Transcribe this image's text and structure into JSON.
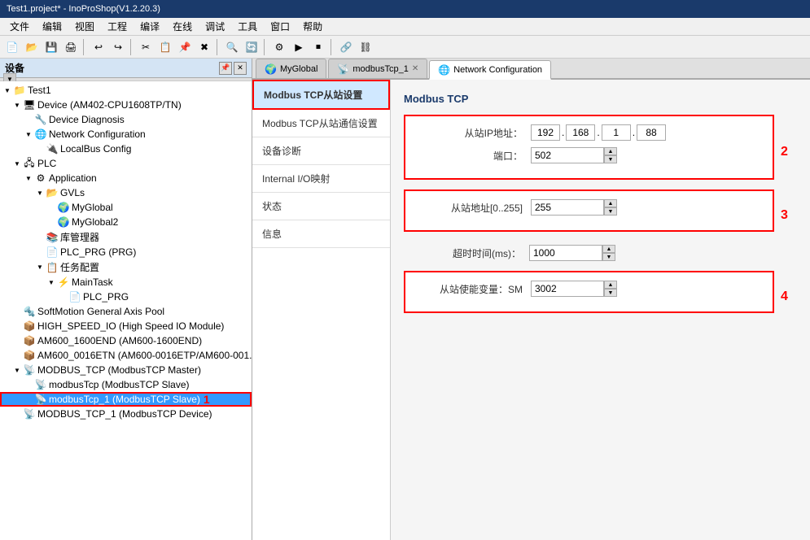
{
  "window": {
    "title": "Test1.project* - InoProShop(V1.2.20.3)"
  },
  "menubar": {
    "items": [
      "文件",
      "编辑",
      "视图",
      "工程",
      "编译",
      "在线",
      "调试",
      "工具",
      "窗口",
      "帮助"
    ]
  },
  "left_panel": {
    "title": "设备",
    "tree": [
      {
        "id": "test1",
        "label": "Test1",
        "level": 0,
        "icon": "folder"
      },
      {
        "id": "device",
        "label": "Device (AM402-CPU1608TP/TN)",
        "level": 1,
        "icon": "device"
      },
      {
        "id": "device-diag",
        "label": "Device Diagnosis",
        "level": 2,
        "icon": "diag"
      },
      {
        "id": "net-config",
        "label": "Network Configuration",
        "level": 2,
        "icon": "network"
      },
      {
        "id": "localbus",
        "label": "LocalBus Config",
        "level": 3,
        "icon": "bus"
      },
      {
        "id": "plc",
        "label": "PLC",
        "level": 1,
        "icon": "plc"
      },
      {
        "id": "app",
        "label": "Application",
        "level": 2,
        "icon": "app"
      },
      {
        "id": "gvls",
        "label": "GVLs",
        "level": 3,
        "icon": "folder"
      },
      {
        "id": "myglobal",
        "label": "MyGlobal",
        "level": 4,
        "icon": "globe"
      },
      {
        "id": "myglobal2",
        "label": "MyGlobal2",
        "level": 4,
        "icon": "globe"
      },
      {
        "id": "lib-mgr",
        "label": "库管理器",
        "level": 3,
        "icon": "lib"
      },
      {
        "id": "plc-prg",
        "label": "PLC_PRG (PRG)",
        "level": 3,
        "icon": "pou"
      },
      {
        "id": "tasks",
        "label": "任务配置",
        "level": 3,
        "icon": "task"
      },
      {
        "id": "maintask",
        "label": "MainTask",
        "level": 4,
        "icon": "task2"
      },
      {
        "id": "plc-prg2",
        "label": "PLC_PRG",
        "level": 5,
        "icon": "pou2"
      },
      {
        "id": "softmotion",
        "label": "SoftMotion General Axis Pool",
        "level": 1,
        "icon": "motion"
      },
      {
        "id": "high-speed",
        "label": "HIGH_SPEED_IO (High Speed IO Module)",
        "level": 1,
        "icon": "io"
      },
      {
        "id": "am600-1600end",
        "label": "AM600_1600END (AM600-1600END)",
        "level": 1,
        "icon": "am600"
      },
      {
        "id": "am600-0016etn",
        "label": "AM600_0016ETN (AM600-0016ETP/AM600-001...",
        "level": 1,
        "icon": "am600"
      },
      {
        "id": "modbus-tcp",
        "label": "MODBUS_TCP (ModbusTCP Master)",
        "level": 1,
        "icon": "modbus"
      },
      {
        "id": "modbustcp",
        "label": "modbusTcp (ModbusTCP Slave)",
        "level": 2,
        "icon": "slave"
      },
      {
        "id": "modbustcp1",
        "label": "modbusTcp_1 (ModbusTCP Slave)",
        "level": 2,
        "icon": "slave",
        "selected": true,
        "highlighted": true
      },
      {
        "id": "modbus-tcp-1",
        "label": "MODBUS_TCP_1 (ModbusTCP Device)",
        "level": 1,
        "icon": "modbus"
      }
    ]
  },
  "tabs": [
    {
      "id": "myglobal-tab",
      "label": "MyGlobal",
      "icon": "globe",
      "closable": false,
      "active": false
    },
    {
      "id": "modbustcp1-tab",
      "label": "modbusTcp_1",
      "icon": "slave",
      "closable": true,
      "active": false
    },
    {
      "id": "netconfig-tab",
      "label": "Network Configuration",
      "icon": "network",
      "closable": false,
      "active": true
    }
  ],
  "nav_items": [
    {
      "id": "modbus-tcp-slave",
      "label": "Modbus TCP从站设置",
      "active": true,
      "highlighted": true
    },
    {
      "id": "modbus-tcp-comm",
      "label": "Modbus TCP从站通信设置",
      "active": false
    },
    {
      "id": "device-diag",
      "label": "设备诊断",
      "active": false
    },
    {
      "id": "internal-io",
      "label": "Internal I/O映射",
      "active": false
    },
    {
      "id": "status",
      "label": "状态",
      "active": false
    },
    {
      "id": "info",
      "label": "信息",
      "active": false
    }
  ],
  "modbus_tcp": {
    "section_title": "Modbus TCP",
    "slave_ip_label": "从站IP地址：",
    "ip_seg1": "192",
    "ip_seg2": "168",
    "ip_seg3": "1",
    "ip_seg4": "88",
    "port_label": "端口：",
    "port_value": "502",
    "slave_addr_label": "从站地址[0..255]",
    "slave_addr_value": "255",
    "timeout_label": "超时时间(ms)：",
    "timeout_value": "1000",
    "slave_var_label": "从站使能变量：SM",
    "slave_var_value": "3002",
    "label_2": "2",
    "label_3": "3",
    "label_4": "4"
  }
}
